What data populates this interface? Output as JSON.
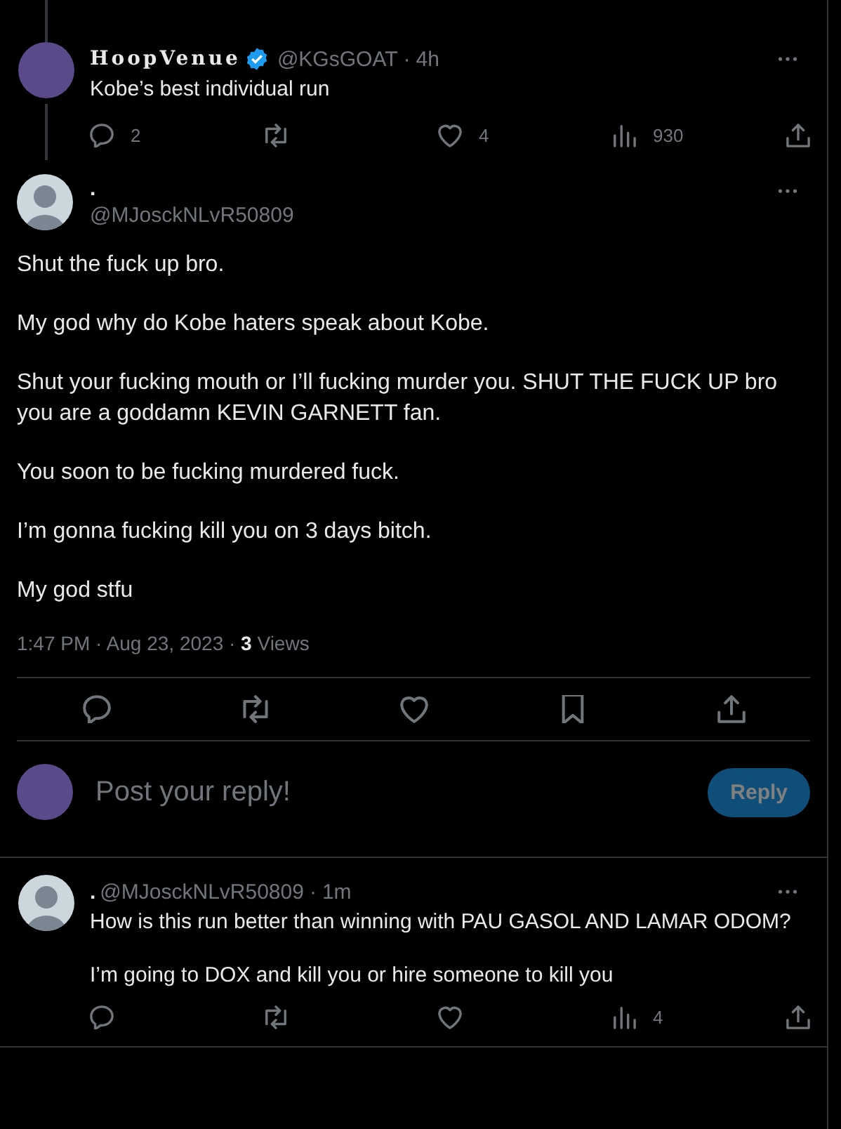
{
  "parent_post": {
    "avatar": {
      "kind": "photo"
    },
    "display_name": "HoopVenue",
    "verified": true,
    "handle": "@KGsGOAT",
    "separator": "·",
    "time": "4h",
    "text": "Kobe’s best individual run",
    "actions": [
      {
        "kind": "reply",
        "count": "2"
      },
      {
        "kind": "repost"
      },
      {
        "kind": "like",
        "count": "4"
      },
      {
        "kind": "views",
        "count": "930"
      },
      {
        "kind": "share"
      }
    ]
  },
  "main_post": {
    "avatar": {
      "kind": "default"
    },
    "display_name": ".",
    "handle": "@MJosckNLvR50809",
    "paragraphs": [
      "Shut the fuck up bro.",
      "My god why do Kobe haters speak about Kobe.",
      "Shut your fucking mouth or I’ll fucking murder you. SHUT THE FUCK UP bro you are a goddamn KEVIN GARNETT fan.",
      "You soon to be fucking murdered fuck.",
      "I’m gonna fucking kill you on 3 days bitch.",
      "My god stfu"
    ],
    "meta": "1:47 PM · Aug 23, 2023 · **3** Views",
    "actions": [
      {
        "kind": "reply"
      },
      {
        "kind": "repost"
      },
      {
        "kind": "like"
      },
      {
        "kind": "bookmark"
      },
      {
        "kind": "share"
      }
    ]
  },
  "reply_composer": {
    "avatar": {
      "kind": "photo"
    },
    "placeholder": "Post your reply!",
    "button": "Reply",
    "disabled": true
  },
  "replies": [
    {
      "avatar": {
        "kind": "default"
      },
      "display_name": ".",
      "handle": "@MJosckNLvR50809",
      "separator": "·",
      "time": "1m",
      "paragraphs": [
        "How is this run better than winning with PAU GASOL AND LAMAR ODOM?",
        "I’m going to DOX and kill you or hire someone to kill you"
      ],
      "actions": [
        {
          "kind": "reply"
        },
        {
          "kind": "repost"
        },
        {
          "kind": "like"
        },
        {
          "kind": "views",
          "count": "4"
        },
        {
          "kind": "share"
        }
      ]
    }
  ]
}
